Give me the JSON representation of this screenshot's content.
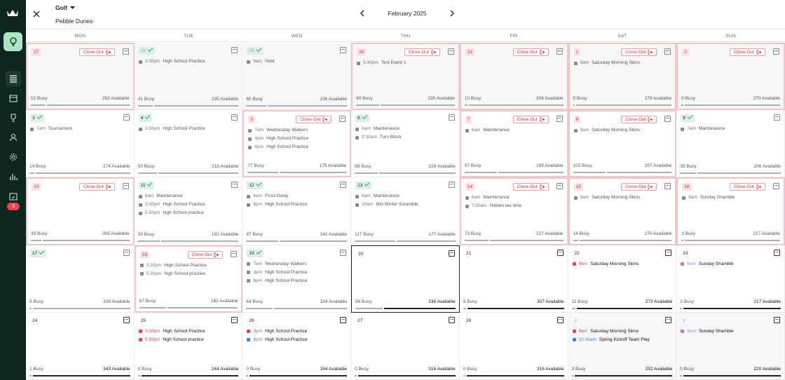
{
  "header": {
    "sport": "Golf",
    "course": "Pebble Dunes",
    "month": "February 2025"
  },
  "sidebar": {
    "badge": "3"
  },
  "weekdays": [
    "MON",
    "TUE",
    "WED",
    "THU",
    "FRI",
    "SAT",
    "SUN"
  ],
  "close_out_label": "Close Out",
  "colors": {
    "sidebar": "#0f2620",
    "active": "#a8e6bf",
    "closeout": "#d33",
    "check": "#3aa36b"
  },
  "cells": [
    {
      "day": "27",
      "state": "closed",
      "past": true,
      "events": [],
      "busy": "52 Busy",
      "available": "292 Available"
    },
    {
      "day": "28",
      "state": "done",
      "past": true,
      "events": [
        {
          "time": "3:30pm",
          "name": "High School Practice",
          "color": "#8a8a8a"
        }
      ],
      "busy": "41 Busy",
      "available": "235 Available"
    },
    {
      "day": "29",
      "state": "done",
      "past": true,
      "events": [
        {
          "time": "6am",
          "name": "Hold",
          "color": "#8a8a8a"
        }
      ],
      "busy": "60 Busy",
      "available": "236 Available"
    },
    {
      "day": "30",
      "state": "closed",
      "past": true,
      "events": [
        {
          "time": "5:40pm",
          "name": "Test Event 1",
          "color": "#8a8a8a"
        }
      ],
      "busy": "69 Busy",
      "available": "235 Available"
    },
    {
      "day": "31",
      "state": "closed",
      "past": true,
      "events": [],
      "busy": "10 Busy",
      "available": "306 Available"
    },
    {
      "day": "1",
      "state": "closed",
      "past": true,
      "events": [
        {
          "time": "9am",
          "name": "Saturday Morning Skins",
          "color": "#8a8a8a"
        }
      ],
      "busy": "5 Busy",
      "available": "279 Available"
    },
    {
      "day": "2",
      "state": "closed",
      "past": true,
      "events": [],
      "busy": "0 Busy",
      "available": "270 Available"
    },
    {
      "day": "3",
      "state": "check",
      "events": [
        {
          "time": "7am",
          "name": "Tournament",
          "color": "#8a8a8a"
        }
      ],
      "busy": "14 Busy",
      "available": "274 Available"
    },
    {
      "day": "4",
      "state": "check",
      "events": [
        {
          "time": "3:30pm",
          "name": "High School Practice",
          "color": "#8a8a8a"
        }
      ],
      "busy": "50 Busy",
      "available": "218 Available"
    },
    {
      "day": "5",
      "state": "closed",
      "events": [
        {
          "time": "7am",
          "name": "Wednesday Walkers",
          "color": "#8a8a8a"
        },
        {
          "time": "4pm",
          "name": "High School Practice",
          "color": "#8a8a8a"
        },
        {
          "time": "6pm",
          "name": "High School Practice",
          "color": "#8a8a8a"
        }
      ],
      "busy": "77 Busy",
      "available": "175 Available"
    },
    {
      "day": "6",
      "state": "check",
      "events": [
        {
          "time": "6am",
          "name": "Maintenance",
          "color": "#8a8a8a"
        },
        {
          "time": "9:30am",
          "name": "Turn Block",
          "color": "#8a8a8a"
        }
      ],
      "busy": "68 Busy",
      "available": "228 Available"
    },
    {
      "day": "7",
      "state": "closed",
      "events": [
        {
          "time": "6am",
          "name": "Maintenance",
          "color": "#8a8a8a"
        }
      ],
      "busy": "97 Busy",
      "available": "199 Available"
    },
    {
      "day": "8",
      "state": "closed",
      "events": [
        {
          "time": "9am",
          "name": "Saturday Morning Skins",
          "color": "#8a8a8a"
        }
      ],
      "busy": "102 Busy",
      "available": "207 Available"
    },
    {
      "day": "9",
      "state": "check",
      "events": [
        {
          "time": "7am",
          "name": "Maintenance",
          "color": "#8a8a8a"
        }
      ],
      "busy": "39 Busy",
      "available": "206 Available"
    },
    {
      "day": "10",
      "state": "closed",
      "events": [],
      "busy": "39 Busy",
      "available": "305 Available"
    },
    {
      "day": "11",
      "state": "check",
      "events": [
        {
          "time": "6am",
          "name": "Maintenance",
          "color": "#8a8a8a"
        },
        {
          "time": "3:30pm",
          "name": "High School Practice",
          "color": "#8a8a8a"
        },
        {
          "time": "5:30pm",
          "name": "high School practice",
          "color": "#8a8a8a"
        }
      ],
      "busy": "50 Busy",
      "available": "182 Available"
    },
    {
      "day": "12",
      "state": "check",
      "events": [
        {
          "time": "6am",
          "name": "Frost Delay",
          "color": "#8a8a8a"
        },
        {
          "time": "6pm",
          "name": "High School Practice",
          "color": "#8a8a8a"
        }
      ],
      "busy": "87 Busy",
      "available": "181 Available"
    },
    {
      "day": "13",
      "state": "check",
      "events": [
        {
          "time": "6am",
          "name": "Maintenance",
          "color": "#8a8a8a"
        },
        {
          "time": "10am",
          "name": "Mid Winter Scramble",
          "color": "#8a8a8a"
        }
      ],
      "busy": "117 Busy",
      "available": "177 Available"
    },
    {
      "day": "14",
      "state": "closed",
      "events": [
        {
          "time": "6am",
          "name": "Maintenance",
          "color": "#8a8a8a"
        },
        {
          "time": "7:50am",
          "name": "Hidden tee time",
          "color": "#8a8a8a"
        }
      ],
      "busy": "73 Busy",
      "available": "227 Available"
    },
    {
      "day": "15",
      "state": "closed",
      "events": [
        {
          "time": "9am",
          "name": "Saturday Morning Skins",
          "color": "#8a8a8a"
        }
      ],
      "busy": "14 Busy",
      "available": "270 Available"
    },
    {
      "day": "16",
      "state": "closed",
      "events": [
        {
          "time": "9am",
          "name": "Sunday Shamble",
          "color": "#8a8a8a"
        }
      ],
      "busy": "3 Busy",
      "available": "217 Available"
    },
    {
      "day": "17",
      "state": "check",
      "events": [],
      "busy": "5 Busy",
      "available": "339 Available"
    },
    {
      "day": "18",
      "state": "closed",
      "events": [
        {
          "time": "3:30pm",
          "name": "High School Practice",
          "color": "#8a8a8a"
        },
        {
          "time": "5:30pm",
          "name": "high School practice",
          "color": "#8a8a8a"
        }
      ],
      "busy": "67 Busy",
      "available": "181 Available"
    },
    {
      "day": "19",
      "state": "check",
      "events": [
        {
          "time": "7am",
          "name": "Wednesday Walkers",
          "color": "#8a8a8a"
        },
        {
          "time": "3pm",
          "name": "High School Practice",
          "color": "#8a8a8a"
        },
        {
          "time": "6pm",
          "name": "High School Practice",
          "color": "#8a8a8a"
        }
      ],
      "busy": "64 Busy",
      "available": "184 Available"
    },
    {
      "day": "20",
      "state": "today",
      "future": true,
      "events": [],
      "busy": "88 Busy",
      "available": "236 Available"
    },
    {
      "day": "21",
      "state": "plain",
      "future": true,
      "events": [],
      "busy": "9 Busy",
      "available": "307 Available"
    },
    {
      "day": "22",
      "state": "plain",
      "future": true,
      "events": [
        {
          "time": "9am",
          "name": "Saturday Morning Skins",
          "color": "#e5484d"
        }
      ],
      "busy": "11 Busy",
      "available": "273 Available"
    },
    {
      "day": "23",
      "state": "plain",
      "future": true,
      "events": [
        {
          "time": "9am",
          "name": "Sunday Shamble",
          "color": "#b07de8"
        }
      ],
      "busy": "3 Busy",
      "available": "217 Available"
    },
    {
      "day": "24",
      "state": "plain",
      "future": true,
      "events": [],
      "busy": "1 Busy",
      "available": "343 Available"
    },
    {
      "day": "25",
      "state": "plain",
      "future": true,
      "events": [
        {
          "time": "3:30pm",
          "name": "High School Practice",
          "color": "#e5484d"
        },
        {
          "time": "5:30pm",
          "name": "high School practice",
          "color": "#e5484d"
        }
      ],
      "busy": "0 Busy",
      "available": "244 Available"
    },
    {
      "day": "26",
      "state": "plain",
      "future": true,
      "events": [
        {
          "time": "3pm",
          "name": "High School Practice",
          "color": "#e5484d"
        },
        {
          "time": "6pm",
          "name": "High School Practice",
          "color": "#3b82f6"
        }
      ],
      "busy": "0 Busy",
      "available": "264 Available"
    },
    {
      "day": "27",
      "state": "plain",
      "future": true,
      "events": [],
      "busy": "0 Busy",
      "available": "316 Available"
    },
    {
      "day": "28",
      "state": "plain",
      "future": true,
      "events": [],
      "busy": "0 Busy",
      "available": "316 Available"
    },
    {
      "day": "1",
      "state": "fade",
      "future": true,
      "outside": true,
      "events": [
        {
          "time": "9am",
          "name": "Saturday Morning Skins",
          "color": "#e5484d"
        },
        {
          "time": "10:30am",
          "name": "Spring Kickoff Team Play",
          "color": "#3b82f6"
        }
      ],
      "busy": "0 Busy",
      "available": "252 Available"
    },
    {
      "day": "2",
      "state": "fade",
      "future": true,
      "outside": true,
      "events": [
        {
          "time": "9am",
          "name": "Sunday Shamble",
          "color": "#b07de8"
        }
      ],
      "busy": "0 Busy",
      "available": "220 Available"
    }
  ]
}
